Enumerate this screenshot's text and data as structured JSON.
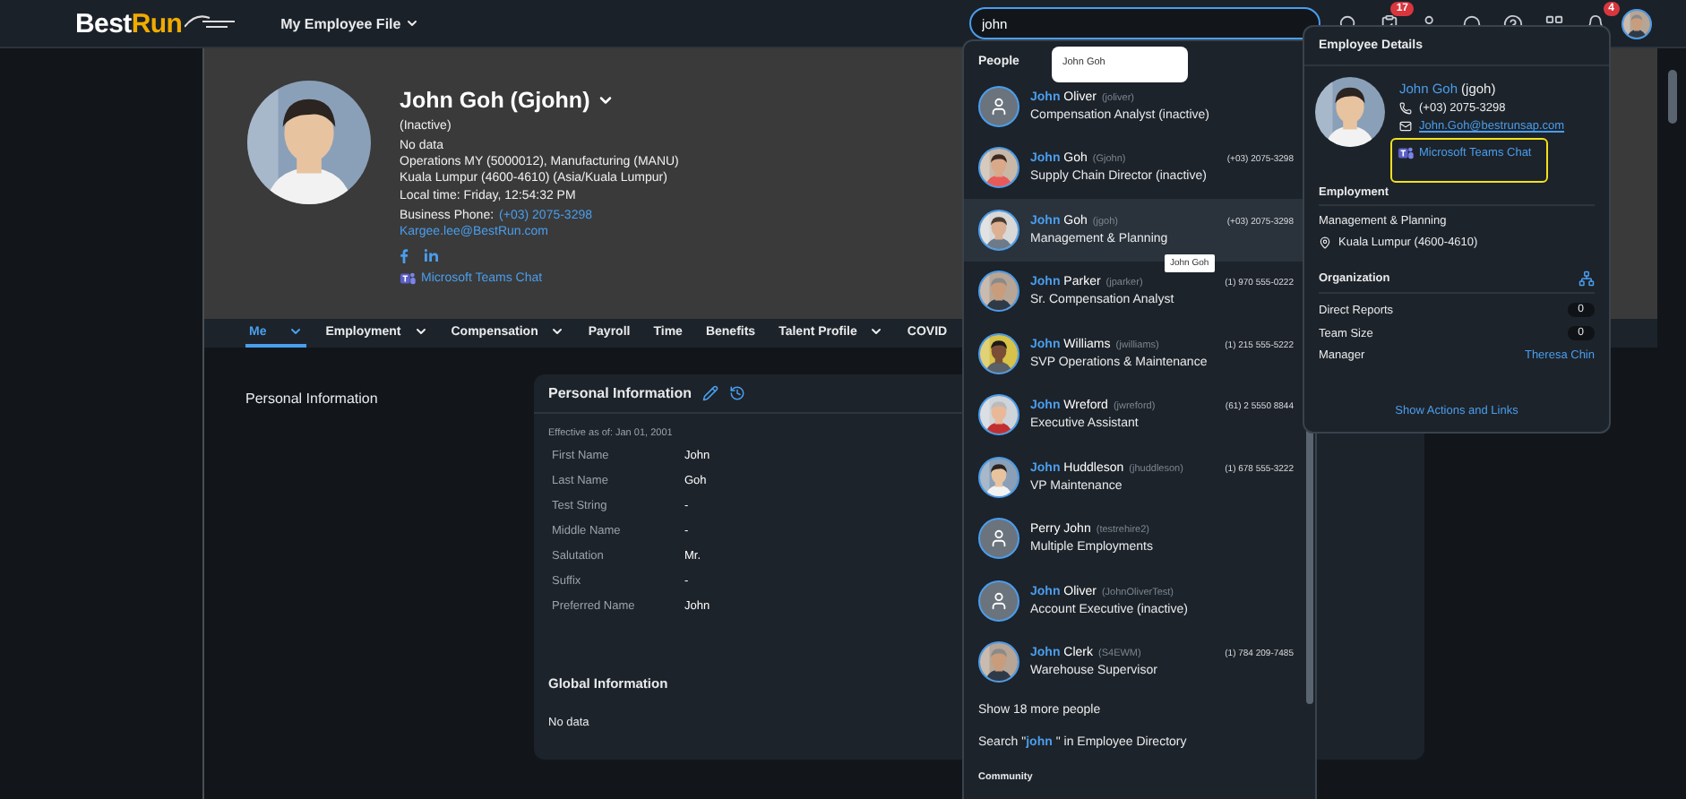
{
  "topbar": {
    "logo_main": "Best",
    "logo_accent": "Run",
    "title": "My Employee File",
    "search": {
      "value": "john"
    },
    "icons": [
      {
        "kind": "search"
      },
      {
        "kind": "tasks",
        "badge": "17"
      },
      {
        "kind": "people"
      },
      {
        "kind": "headset"
      },
      {
        "kind": "help"
      },
      {
        "kind": "apps"
      },
      {
        "kind": "bell",
        "badge": "4"
      },
      {
        "kind": "avatar"
      }
    ]
  },
  "profile": {
    "name": "John Goh (Gjohn)",
    "status": "(Inactive)",
    "lines": [
      "No data",
      "Operations MY (5000012), Manufacturing (MANU)",
      "Kuala Lumpur (4600-4610) (Asia/Kuala Lumpur)"
    ],
    "local_time": "Local time: Friday, 12:54:32 PM",
    "phone_label": "Business Phone:",
    "phone": "(+03) 2075-3298",
    "email": "Kargee.lee@BestRun.com",
    "socials": [
      {
        "kind": "facebook"
      },
      {
        "kind": "linkedin"
      }
    ],
    "teams": "Microsoft Teams Chat"
  },
  "tabs": [
    {
      "label": "Me",
      "selected": true,
      "has_menu": true
    },
    {
      "label": "Employment",
      "selected": false,
      "has_menu": true
    },
    {
      "label": "Compensation",
      "selected": false,
      "has_menu": true
    },
    {
      "label": "Payroll",
      "selected": false,
      "has_menu": false
    },
    {
      "label": "Time",
      "selected": false,
      "has_menu": false
    },
    {
      "label": "Benefits",
      "selected": false,
      "has_menu": false
    },
    {
      "label": "Talent Profile",
      "selected": false,
      "has_menu": true
    },
    {
      "label": "COVID",
      "selected": false,
      "has_menu": false
    }
  ],
  "section_label": "Personal Information",
  "card": {
    "title": "Personal Information",
    "effective": "Effective as of: Jan 01, 2001",
    "fields": [
      {
        "label": "First Name",
        "value": "John"
      },
      {
        "label": "Last Name",
        "value": "Goh"
      },
      {
        "label": "Test String",
        "value": "-"
      },
      {
        "label": "Middle Name",
        "value": "-"
      },
      {
        "label": "Salutation",
        "value": "Mr."
      },
      {
        "label": "Suffix",
        "value": "-"
      },
      {
        "label": "Preferred Name",
        "value": "John"
      }
    ],
    "global_title": "Global Information",
    "global_value": "No data"
  },
  "search_results": {
    "heading": "People",
    "people": [
      {
        "name": "**John** Oliver",
        "userid": "(joliver)",
        "title": "Compensation Analyst (inactive)",
        "kind": "placeholder",
        "hovered": false
      },
      {
        "name": "**John** Goh",
        "userid": "(Gjohn)",
        "phone": "(+03) 2075-3298",
        "title": "Supply Chain Director (inactive)",
        "kind": "picture",
        "hovered": false
      },
      {
        "name": "**John** Goh",
        "userid": "(jgoh)",
        "phone": "(+03) 2075-3298",
        "title": "Management & Planning",
        "kind": "picture",
        "hovered": true
      },
      {
        "name": "**John** Parker",
        "userid": "(jparker)",
        "phone": "(1) 970 555-0222",
        "title": "Sr. Compensation Analyst",
        "kind": "picture",
        "hovered": false
      },
      {
        "name": "**John** Williams",
        "userid": "(jwilliams)",
        "phone": "(1) 215 555-5222",
        "title": "SVP Operations & Maintenance",
        "kind": "picture",
        "hovered": false
      },
      {
        "name": "**John** Wreford",
        "userid": "(jwreford)",
        "phone": "(61) 2 5550 8844",
        "title": "Executive Assistant",
        "kind": "picture",
        "hovered": false
      },
      {
        "name": "**John** Huddleson",
        "userid": "(jhuddleson)",
        "phone": "(1) 678 555-3222",
        "title": "VP Maintenance",
        "kind": "picture",
        "hovered": false
      },
      {
        "name": "Perry John",
        "userid": "(testrehire2)",
        "title": "Multiple Employments",
        "kind": "placeholder",
        "hovered": false
      },
      {
        "name": "**John** Oliver",
        "userid": "(JohnOliverTest)",
        "title": "Account Executive (inactive)",
        "kind": "placeholder",
        "hovered": false
      },
      {
        "name": "**John** Clerk",
        "userid": "(S4EWM)",
        "phone": "(1) 784 209-7485",
        "title": "Warehouse Supervisor",
        "kind": "picture",
        "hovered": false
      }
    ],
    "more": "Show 18 more people",
    "directory": "Search \"**john** \" in Employee Directory",
    "community": "Community"
  },
  "tooltips": [
    {
      "text": "John Goh"
    },
    {
      "text": "John Goh"
    }
  ],
  "details": {
    "title": "Employee Details",
    "name": "John Goh",
    "userid": "(jgoh)",
    "phone": "(+03) 2075-3298",
    "email": "John.Goh@bestrunsap.com",
    "teams": "Microsoft Teams Chat",
    "teams_highlighted": true,
    "employment_heading": "Employment",
    "department": "Management & Planning",
    "location": "Kuala Lumpur (4600-4610)",
    "organization_heading": "Organization",
    "rows": [
      {
        "label": "Direct Reports",
        "value": "0",
        "kind": "count"
      },
      {
        "label": "Team Size",
        "value": "0",
        "kind": "count"
      },
      {
        "label": "Manager",
        "value": "Theresa Chin",
        "kind": "link"
      }
    ],
    "footer": "Show Actions and Links"
  }
}
